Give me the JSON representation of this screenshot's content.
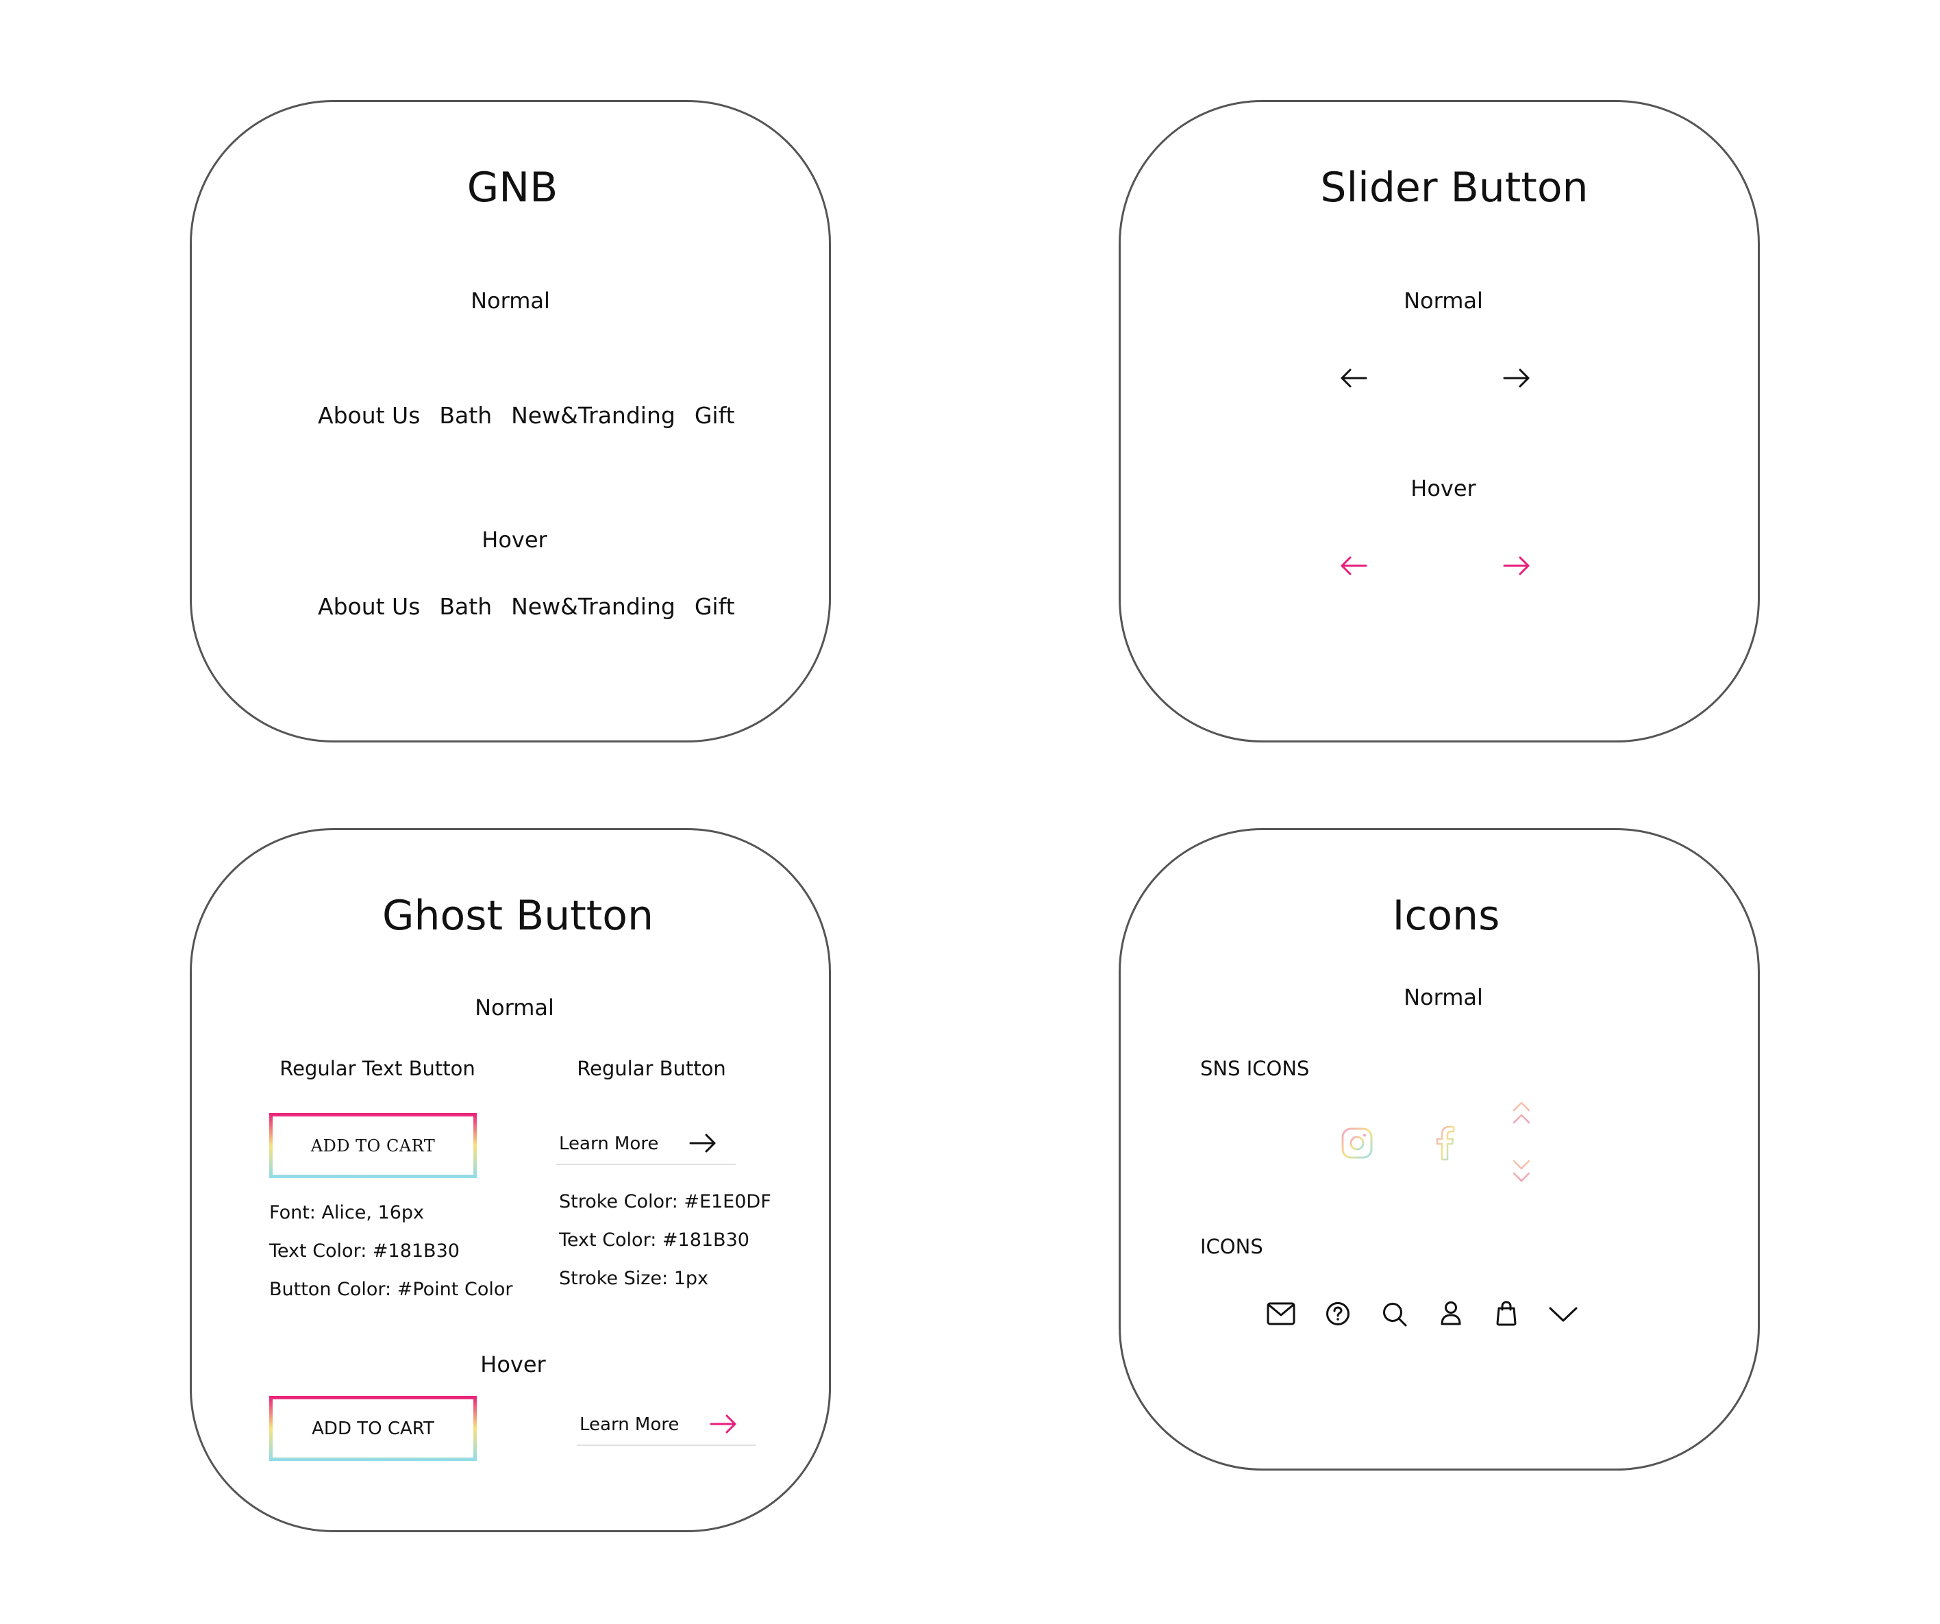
{
  "colors": {
    "border": "#555555",
    "text": "#181B30",
    "accent": "#E91E7B",
    "stroke": "#E1E0DF"
  },
  "gnb": {
    "title": "GNB",
    "normal_label": "Normal",
    "hover_label": "Hover",
    "items": [
      "About Us",
      "Bath",
      "New&Tranding",
      "Gift"
    ]
  },
  "slider": {
    "title": "Slider Button",
    "normal_label": "Normal",
    "hover_label": "Hover",
    "icons": [
      "arrow-left-icon",
      "arrow-right-icon"
    ]
  },
  "ghost": {
    "title": "Ghost Button",
    "normal_label": "Normal",
    "hover_label": "Hover",
    "regular_text_button": {
      "heading": "Regular Text Button",
      "label": "ADD TO CART",
      "specs": [
        "Font: Alice, 16px",
        "Text Color: #181B30",
        "Button Color: #Point Color"
      ]
    },
    "regular_button": {
      "heading": "Regular Button",
      "label": "Learn More",
      "specs": [
        "Stroke Color: #E1E0DF",
        "Text Color: #181B30",
        "Stroke Size: 1px"
      ]
    },
    "hover_add_label": "ADD TO CART",
    "hover_learn_label": "Learn More"
  },
  "icons": {
    "title": "Icons",
    "normal_label": "Normal",
    "sns_heading": "SNS ICONS",
    "icons_heading": "ICONS",
    "sns_icons": [
      "instagram-icon",
      "facebook-icon",
      "scroll-up-down-icon"
    ],
    "ui_icons": [
      "mail-icon",
      "help-icon",
      "search-icon",
      "user-icon",
      "bag-icon",
      "chevron-down-icon"
    ]
  }
}
